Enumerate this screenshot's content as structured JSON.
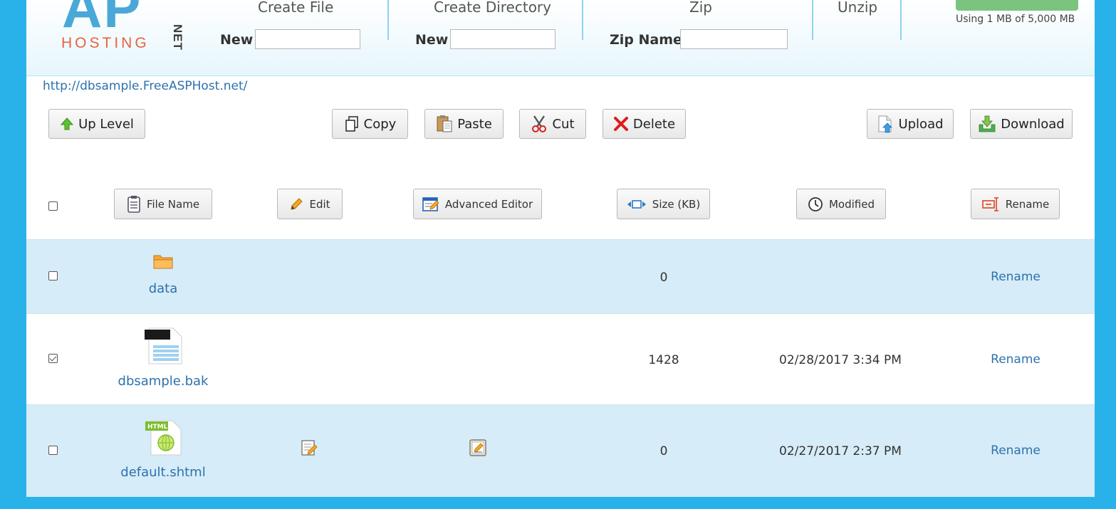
{
  "header": {
    "create_file": {
      "title": "Create File",
      "label": "New",
      "value": ""
    },
    "create_directory": {
      "title": "Create Directory",
      "label": "New",
      "value": ""
    },
    "zip": {
      "title": "Zip",
      "label": "Zip Name",
      "value": ""
    },
    "unzip": {
      "title": "Unzip"
    },
    "usage_text": "Using 1 MB of 5,000 MB",
    "usage_fraction": 0.0002,
    "logo_net": "NET",
    "logo_hosting": "HOSTING"
  },
  "site_url": "http://dbsample.FreeASPHost.net/",
  "toolbar": {
    "up_level": "Up Level",
    "copy": "Copy",
    "paste": "Paste",
    "cut": "Cut",
    "delete": "Delete",
    "upload": "Upload",
    "download": "Download"
  },
  "columns": {
    "file_name": "File Name",
    "edit": "Edit",
    "advanced_editor": "Advanced Editor",
    "size": "Size (KB)",
    "modified": "Modified",
    "rename": "Rename"
  },
  "rows": [
    {
      "name": "data",
      "type": "folder",
      "size": "0",
      "modified": "",
      "rename": "Rename",
      "checked": false
    },
    {
      "name": "dbsample.bak",
      "type": "file",
      "size": "1428",
      "modified": "02/28/2017 3:34 PM",
      "rename": "Rename",
      "checked": true
    },
    {
      "name": "default.shtml",
      "type": "html",
      "size": "0",
      "modified": "02/27/2017 2:37 PM",
      "rename": "Rename",
      "checked": false
    }
  ],
  "colors": {
    "accent": "#29b2e9",
    "link": "#2d72ad",
    "row_alt": "#d6ecf8",
    "logo_orange": "#e9623f",
    "logo_blue": "#4aa8d8"
  },
  "icons": {
    "up_level": "arrow-up-icon",
    "copy": "copy-icon",
    "paste": "paste-icon",
    "cut": "scissors-icon",
    "delete": "x-icon",
    "upload": "upload-icon",
    "download": "download-icon"
  }
}
